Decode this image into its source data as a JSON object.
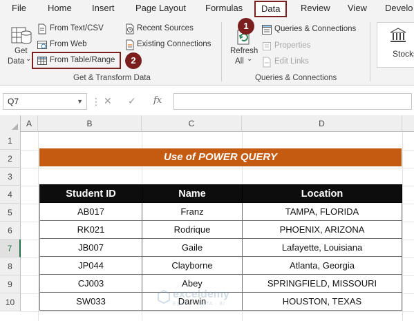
{
  "tabs": [
    "File",
    "Home",
    "Insert",
    "Page Layout",
    "Formulas",
    "Data",
    "Review",
    "View",
    "Develo"
  ],
  "active_tab": "Data",
  "ribbon": {
    "get_data": {
      "line1": "Get",
      "line2": "Data",
      "arrow": "⌄"
    },
    "from_text_csv": "From Text/CSV",
    "from_web": "From Web",
    "from_table_range": "From Table/Range",
    "recent_sources": "Recent Sources",
    "existing_connections": "Existing Connections",
    "get_transform_label": "Get & Transform Data",
    "refresh": {
      "line1": "Refresh",
      "line2": "All",
      "arrow": "⌄"
    },
    "queries_connections": "Queries & Connections",
    "properties": "Properties",
    "edit_links": "Edit Links",
    "queries_group_label": "Queries & Connections",
    "stocks": "Stocks"
  },
  "annotations": {
    "step1": "1",
    "step2": "2"
  },
  "formula_bar": {
    "name_box": "Q7",
    "fx": "fx",
    "value": ""
  },
  "columns": [
    "A",
    "B",
    "C",
    "D"
  ],
  "rows": [
    "1",
    "2",
    "3",
    "4",
    "5",
    "6",
    "7",
    "8",
    "9",
    "10"
  ],
  "selected_row": "7",
  "sheet": {
    "title": "Use of POWER QUERY",
    "headers": [
      "Student ID",
      "Name",
      "Location"
    ],
    "data": [
      [
        "AB017",
        "Franz",
        "TAMPA, FLORIDA"
      ],
      [
        "RK021",
        "Rodrique",
        "PHOENIX, ARIZONA"
      ],
      [
        "JB007",
        "Gaile",
        "Lafayette, Louisiana"
      ],
      [
        "JP044",
        "Clayborne",
        "Atlanta, Georgia"
      ],
      [
        "CJ003",
        "Abey",
        "SPRINGFIELD, MISSOURI"
      ],
      [
        "SW033",
        "Darwin",
        "HOUSTON, TEXAS"
      ]
    ]
  },
  "watermark": {
    "name": "exceldemy",
    "tagline": "EXCEL · DATA · BI"
  },
  "colors": {
    "accent_dark_red": "#7b1e1e",
    "title_orange": "#c55a11",
    "header_black": "#0d0d0d",
    "excel_green": "#217346"
  }
}
